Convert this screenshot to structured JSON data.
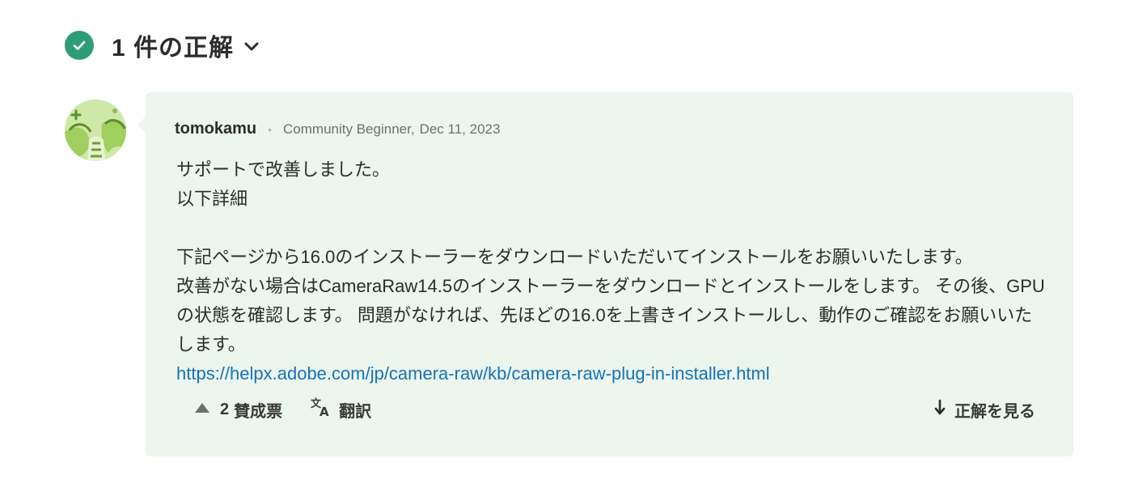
{
  "header": {
    "title": "1 件の正解"
  },
  "post": {
    "author": "tomokamu",
    "rank": "Community Beginner,",
    "date": "Dec 11, 2023",
    "body": {
      "line1": "サポートで改善しました。",
      "line2": "以下詳細",
      "para1": "下記ページから16.0のインストーラーをダウンロードいただいてインストールをお願いいたします。",
      "para2": "改善がない場合はCameraRaw14.5のインストーラーをダウンロードとインストールをします。 その後、GPUの状態を確認します。 問題がなければ、先ほどの16.0を上書きインストールし、動作のご確認をお願いいたします。",
      "link": "https://helpx.adobe.com/jp/camera-raw/kb/camera-raw-plug-in-installer.html"
    }
  },
  "actions": {
    "vote_count": "2",
    "vote_label": "賛成票",
    "translate_label": "翻訳",
    "view_answer_label": "正解を見る"
  },
  "colors": {
    "accepted_green": "#2d9d78",
    "card_background": "#ecf5ee",
    "link_blue": "#1473b8"
  }
}
